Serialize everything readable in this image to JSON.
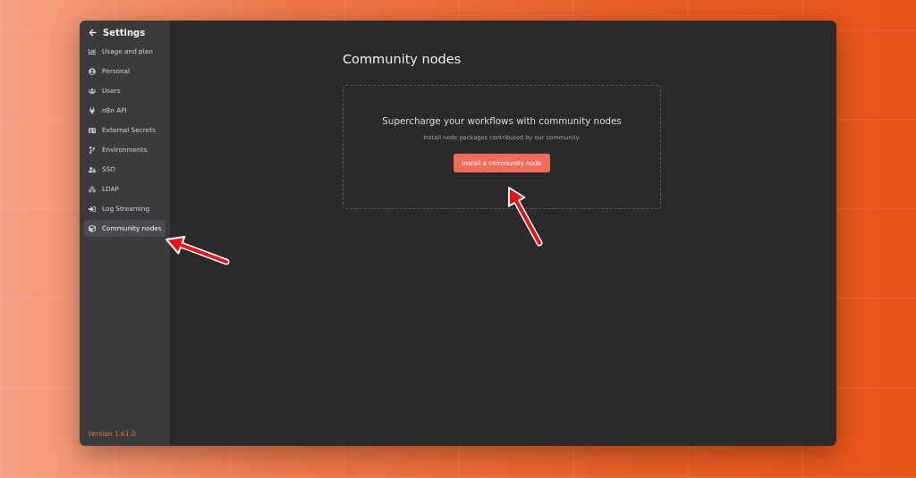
{
  "sidebar": {
    "title": "Settings",
    "items": [
      {
        "label": "Usage and plan",
        "selected": false
      },
      {
        "label": "Personal",
        "selected": false
      },
      {
        "label": "Users",
        "selected": false
      },
      {
        "label": "n8n API",
        "selected": false
      },
      {
        "label": "External Secrets",
        "selected": false
      },
      {
        "label": "Environments",
        "selected": false
      },
      {
        "label": "SSO",
        "selected": false
      },
      {
        "label": "LDAP",
        "selected": false
      },
      {
        "label": "Log Streaming",
        "selected": false
      },
      {
        "label": "Community nodes",
        "selected": true
      }
    ],
    "version": "Version 1.61.0"
  },
  "main": {
    "title": "Community nodes",
    "empty_state": {
      "heading": "Supercharge your workflows with community nodes",
      "description": "Install node packages contributed by our community.",
      "button": "Install a community node"
    }
  }
}
